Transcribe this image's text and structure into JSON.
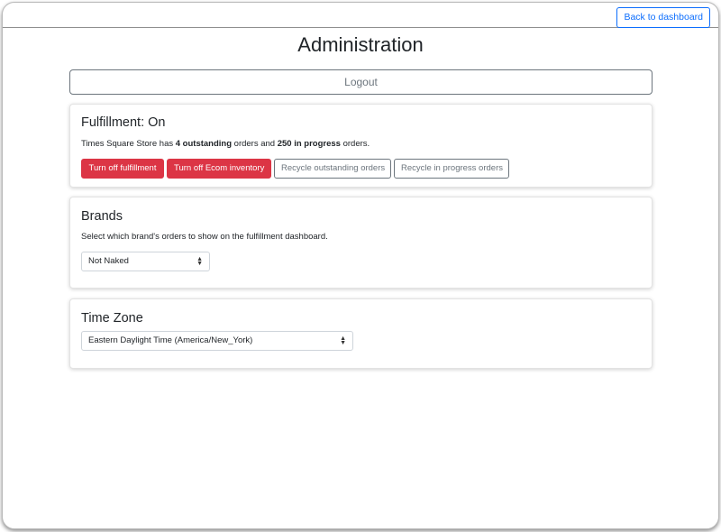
{
  "header": {
    "back_label": "Back to dashboard"
  },
  "page": {
    "title": "Administration",
    "logout_label": "Logout"
  },
  "fulfillment": {
    "title": "Fulfillment: On",
    "store": "Times Square Store",
    "text_has": "has",
    "outstanding": "4 outstanding",
    "text_orders_and": "orders and",
    "in_progress": "250 in progress",
    "text_orders_end": "orders.",
    "buttons": {
      "turn_off_fulfillment": "Turn off fulfillment",
      "turn_off_ecom": "Turn off Ecom inventory",
      "recycle_outstanding": "Recycle outstanding orders",
      "recycle_in_progress": "Recycle in progress orders"
    }
  },
  "brands": {
    "title": "Brands",
    "description": "Select which brand's orders to show on the fulfillment dashboard.",
    "selected": "Not Naked"
  },
  "timezone": {
    "title": "Time Zone",
    "selected": "Eastern Daylight Time (America/New_York)"
  },
  "colors": {
    "danger": "#dc3545",
    "primary": "#0d6efd",
    "secondary": "#6c757d"
  }
}
